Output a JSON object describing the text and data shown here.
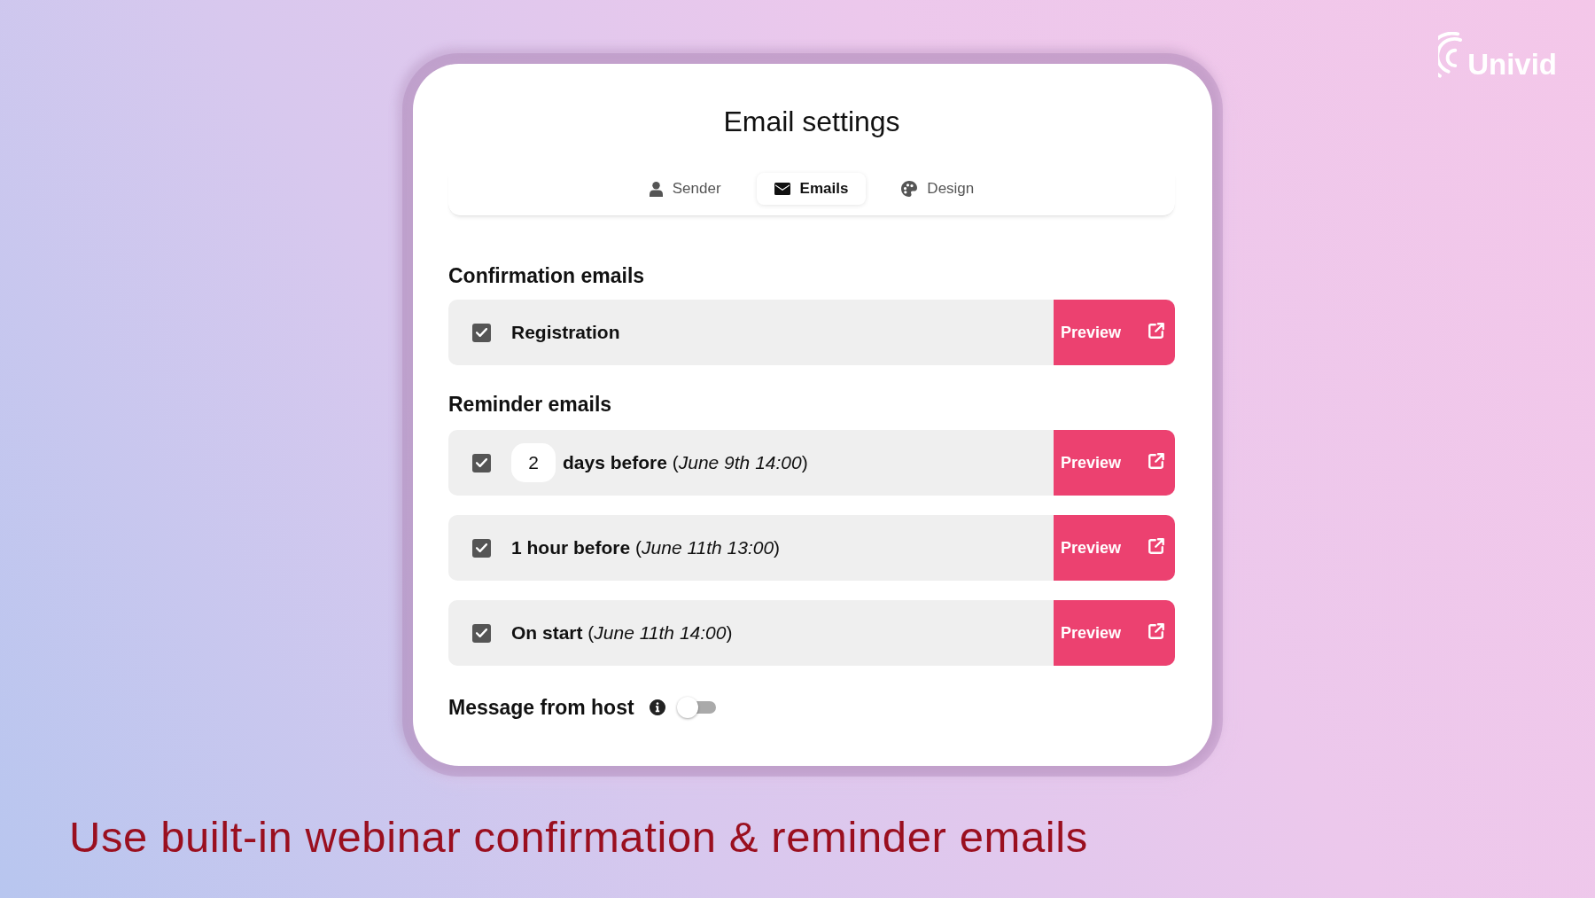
{
  "brand": {
    "name": "Univid"
  },
  "panel": {
    "title": "Email settings"
  },
  "tabs": [
    {
      "label": "Sender",
      "selected": false
    },
    {
      "label": "Emails",
      "selected": true
    },
    {
      "label": "Design",
      "selected": false
    }
  ],
  "sections": [
    {
      "heading": "Confirmation emails",
      "emails": [
        {
          "kind": "plain",
          "checked": true,
          "label": "Registration",
          "preview": "Preview"
        }
      ]
    },
    {
      "heading": "Reminder emails",
      "emails": [
        {
          "kind": "offset",
          "checked": true,
          "count": "2",
          "label": "days before",
          "when": "(*June 9th 14:00*)",
          "preview": "Preview"
        },
        {
          "kind": "plain",
          "checked": true,
          "label": "1 hour before",
          "when": "(*June 11th 13:00*)",
          "preview": "Preview"
        },
        {
          "kind": "plain",
          "checked": true,
          "label": "On start",
          "when": "(*June 11th 14:00*)",
          "preview": "Preview"
        }
      ]
    }
  ],
  "host_message": {
    "label": "Message from host",
    "on": false
  },
  "caption": "Use built-in webinar confirmation & reminder emails"
}
